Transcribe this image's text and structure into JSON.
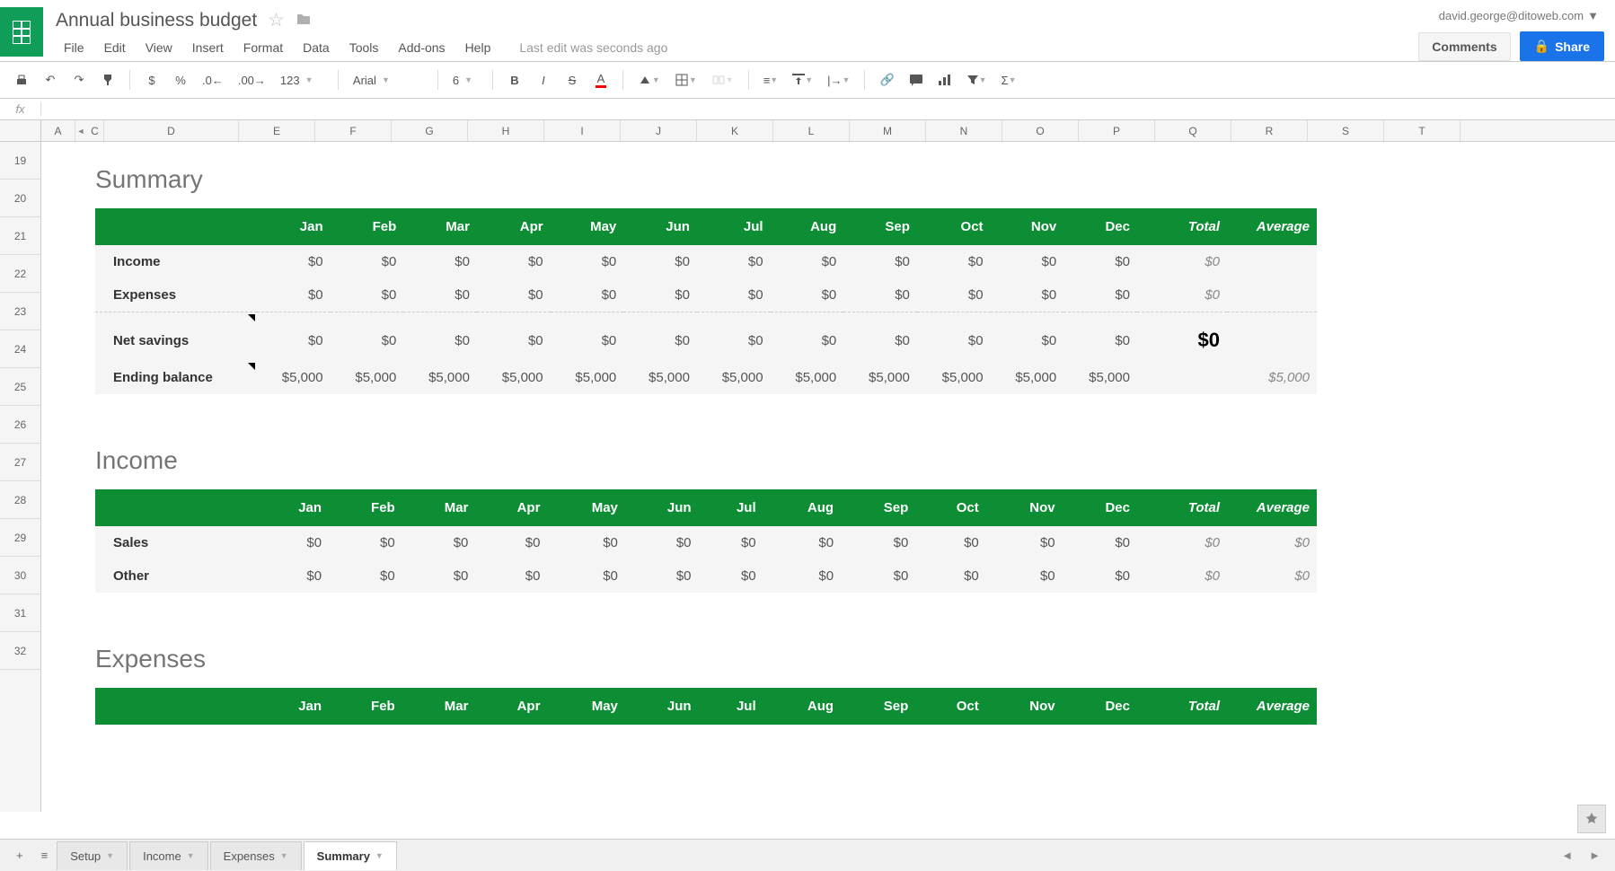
{
  "doc": {
    "title": "Annual business budget"
  },
  "user": {
    "email": "david.george@ditoweb.com"
  },
  "buttons": {
    "comments": "Comments",
    "share": "Share"
  },
  "menus": [
    "File",
    "Edit",
    "View",
    "Insert",
    "Format",
    "Data",
    "Tools",
    "Add-ons",
    "Help"
  ],
  "last_edit": "Last edit was seconds ago",
  "toolbar": {
    "font": "Arial",
    "size": "6",
    "number_format": "123"
  },
  "columns": [
    "A",
    "C",
    "D",
    "E",
    "F",
    "G",
    "H",
    "I",
    "J",
    "K",
    "L",
    "M",
    "N",
    "O",
    "P",
    "Q",
    "R",
    "S",
    "T"
  ],
  "row_numbers": [
    "19",
    "20",
    "21",
    "22",
    "23",
    "24",
    "25",
    "26",
    "27",
    "28",
    "29",
    "30",
    "31",
    "32"
  ],
  "months": [
    "Jan",
    "Feb",
    "Mar",
    "Apr",
    "May",
    "Jun",
    "Jul",
    "Aug",
    "Sep",
    "Oct",
    "Nov",
    "Dec"
  ],
  "header_total": "Total",
  "header_avg": "Average",
  "sections": {
    "summary": {
      "title": "Summary",
      "rows": [
        {
          "label": "Income",
          "vals": [
            "$0",
            "$0",
            "$0",
            "$0",
            "$0",
            "$0",
            "$0",
            "$0",
            "$0",
            "$0",
            "$0",
            "$0"
          ],
          "total": "$0",
          "avg": ""
        },
        {
          "label": "Expenses",
          "vals": [
            "$0",
            "$0",
            "$0",
            "$0",
            "$0",
            "$0",
            "$0",
            "$0",
            "$0",
            "$0",
            "$0",
            "$0"
          ],
          "total": "$0",
          "avg": ""
        },
        {
          "label": "Net savings",
          "vals": [
            "$0",
            "$0",
            "$0",
            "$0",
            "$0",
            "$0",
            "$0",
            "$0",
            "$0",
            "$0",
            "$0",
            "$0"
          ],
          "total": "$0",
          "avg": "",
          "divider": true,
          "big": true,
          "note": true
        },
        {
          "label": "Ending balance",
          "vals": [
            "$5,000",
            "$5,000",
            "$5,000",
            "$5,000",
            "$5,000",
            "$5,000",
            "$5,000",
            "$5,000",
            "$5,000",
            "$5,000",
            "$5,000",
            "$5,000"
          ],
          "total": "",
          "avg": "$5,000",
          "note": true
        }
      ]
    },
    "income": {
      "title": "Income",
      "rows": [
        {
          "label": "Sales",
          "vals": [
            "$0",
            "$0",
            "$0",
            "$0",
            "$0",
            "$0",
            "$0",
            "$0",
            "$0",
            "$0",
            "$0",
            "$0"
          ],
          "total": "$0",
          "avg": "$0"
        },
        {
          "label": "Other",
          "vals": [
            "$0",
            "$0",
            "$0",
            "$0",
            "$0",
            "$0",
            "$0",
            "$0",
            "$0",
            "$0",
            "$0",
            "$0"
          ],
          "total": "$0",
          "avg": "$0"
        }
      ]
    },
    "expenses": {
      "title": "Expenses",
      "rows": []
    }
  },
  "tabs": [
    {
      "name": "Setup",
      "active": false
    },
    {
      "name": "Income",
      "active": false
    },
    {
      "name": "Expenses",
      "active": false
    },
    {
      "name": "Summary",
      "active": true
    }
  ]
}
